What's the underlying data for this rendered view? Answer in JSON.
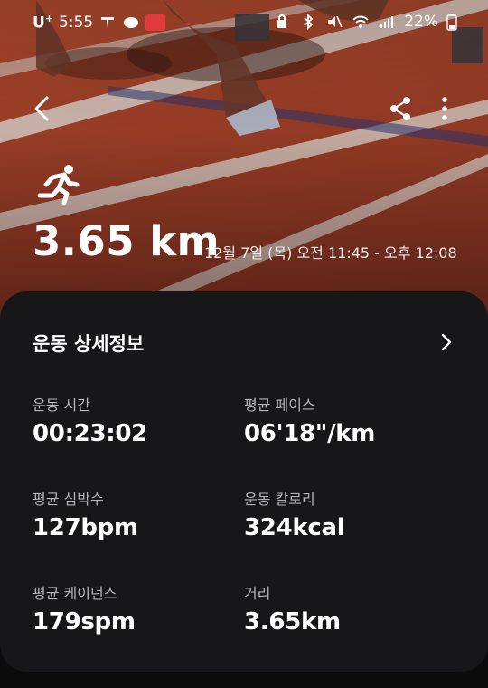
{
  "status_bar": {
    "carrier": "U",
    "carrier_sup": "+",
    "time": "5:55",
    "battery_percent": "22%"
  },
  "header": {
    "distance": "3.65 km",
    "datetime": "12월 7일 (목) 오전 11:45 - 오후 12:08"
  },
  "card": {
    "title": "운동 상세정보",
    "metrics": [
      {
        "label": "운동 시간",
        "value": "00:23:02"
      },
      {
        "label": "평균 페이스",
        "value": "06'18\"/km"
      },
      {
        "label": "평균 심박수",
        "value": "127bpm"
      },
      {
        "label": "운동 칼로리",
        "value": "324kcal"
      },
      {
        "label": "평균 케이던스",
        "value": "179spm"
      },
      {
        "label": "거리",
        "value": "3.65km"
      }
    ]
  },
  "icons": {
    "back": "chevron-left-icon",
    "share": "share-icon",
    "more": "more-vert-icon",
    "activity": "running-icon",
    "detail": "chevron-right-icon"
  },
  "colors": {
    "track": "#a8432b",
    "card": "#171719",
    "label": "#b5b5b8"
  }
}
